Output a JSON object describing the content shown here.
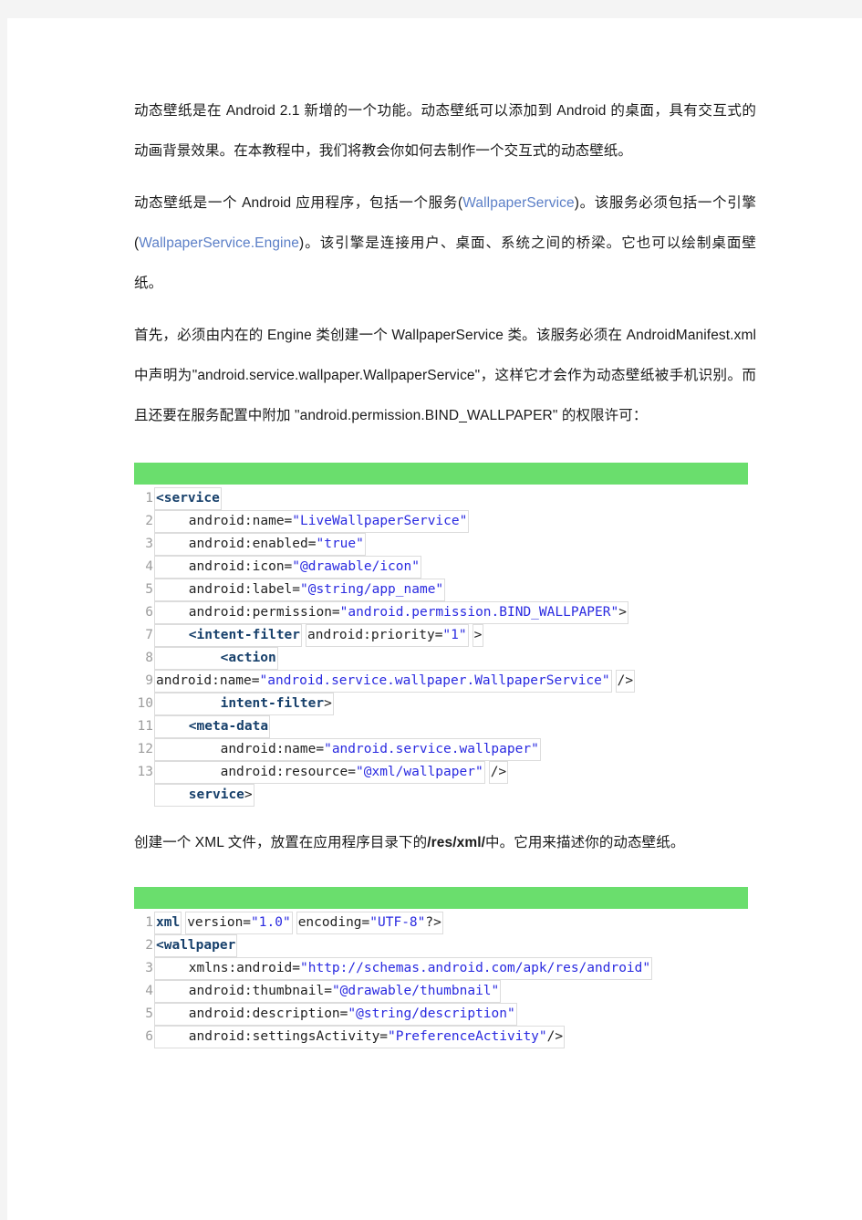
{
  "document": {
    "paragraphs": [
      {
        "id": "p1",
        "runs": [
          {
            "text": "动态壁纸是在 Android 2.1 新增的一个功能。动态壁纸可以添加到 Android 的桌面，具有交互式的动画背景效果。在本教程中，我们将教会你如何去制作一个交互式的动态壁纸。",
            "style": "normal"
          }
        ]
      },
      {
        "id": "p2",
        "runs": [
          {
            "text": "动态壁纸是一个 Android 应用程序，包括一个服务(",
            "style": "normal"
          },
          {
            "text": "WallpaperService",
            "style": "link"
          },
          {
            "text": ")。该服务必须包括一个引擎(",
            "style": "normal"
          },
          {
            "text": "WallpaperService.Engine",
            "style": "link"
          },
          {
            "text": ")。该引擎是连接用户、桌面、系统之间的桥梁。它也可以绘制桌面壁纸。",
            "style": "normal"
          }
        ]
      },
      {
        "id": "p3",
        "runs": [
          {
            "text": "首先，必须由内在的 Engine 类创建一个 WallpaperService 类。该服务必须在 AndroidManifest.xml 中声明为\"android.service.wallpaper.WallpaperService\"，这样它才会作为动态壁纸被手机识别。而且还要在服务配置中附加 \"android.permission.BIND_WALLPAPER\" 的权限许可：",
            "style": "normal"
          }
        ]
      },
      {
        "id": "p4",
        "runs": [
          {
            "text": "创建一个 XML 文件，放置在应用程序目录下的",
            "style": "normal"
          },
          {
            "text": "/res/xml/",
            "style": "bold"
          },
          {
            "text": "中。它用来描述你的动态壁纸。",
            "style": "normal"
          }
        ]
      }
    ],
    "code_blocks": [
      {
        "id": "manifest-service-block",
        "language": "xml",
        "toolbar_color": "#6ade6d",
        "lines": [
          {
            "num": "1",
            "indent": 0,
            "cells": [
              {
                "tokens": [
                  {
                    "t": "<service",
                    "k": "tag"
                  }
                ]
              }
            ]
          },
          {
            "num": "2",
            "indent": 1,
            "cells": [
              {
                "tokens": [
                  {
                    "t": "android:name=",
                    "k": "attr"
                  },
                  {
                    "t": "\"LiveWallpaperService\"",
                    "k": "str"
                  }
                ]
              }
            ]
          },
          {
            "num": "3",
            "indent": 1,
            "cells": [
              {
                "tokens": [
                  {
                    "t": "android:enabled=",
                    "k": "attr"
                  },
                  {
                    "t": "\"true\"",
                    "k": "str"
                  }
                ]
              }
            ]
          },
          {
            "num": "4",
            "indent": 1,
            "cells": [
              {
                "tokens": [
                  {
                    "t": "android:icon=",
                    "k": "attr"
                  },
                  {
                    "t": "\"@drawable/icon\"",
                    "k": "str"
                  }
                ]
              }
            ]
          },
          {
            "num": "5",
            "indent": 1,
            "cells": [
              {
                "tokens": [
                  {
                    "t": "android:label=",
                    "k": "attr"
                  },
                  {
                    "t": "\"@string/app_name\"",
                    "k": "str"
                  }
                ]
              }
            ]
          },
          {
            "num": "6",
            "indent": 1,
            "cells": [
              {
                "tokens": [
                  {
                    "t": "android:permission=",
                    "k": "attr"
                  },
                  {
                    "t": "\"android.permission.BIND_WALLPAPER\"",
                    "k": "str"
                  },
                  {
                    "t": ">",
                    "k": "punct"
                  }
                ]
              }
            ]
          },
          {
            "num": "7",
            "indent": 1,
            "cells": [
              {
                "tokens": [
                  {
                    "t": "<intent-filter",
                    "k": "tag"
                  }
                ]
              },
              {
                "tokens": [
                  {
                    "t": "android:priority=",
                    "k": "attr"
                  },
                  {
                    "t": "\"1\"",
                    "k": "str"
                  }
                ]
              },
              {
                "tokens": [
                  {
                    "t": ">",
                    "k": "punct"
                  }
                ]
              }
            ]
          },
          {
            "num": "8",
            "indent": 2,
            "cells": [
              {
                "tokens": [
                  {
                    "t": "<action",
                    "k": "tag"
                  }
                ]
              }
            ]
          },
          {
            "num": "9",
            "indent": 0,
            "cells": [
              {
                "tokens": [
                  {
                    "t": "android:name=",
                    "k": "attr"
                  },
                  {
                    "t": "\"android.service.wallpaper.WallpaperService\"",
                    "k": "str"
                  }
                ]
              },
              {
                "tokens": [
                  {
                    "t": "/>",
                    "k": "punct"
                  }
                ]
              }
            ]
          },
          {
            "num": "10",
            "indent": 2,
            "cells": [
              {
                "tokens": [
                  {
                    "t": "intent-filter",
                    "k": "tag"
                  },
                  {
                    "t": ">",
                    "k": "punct"
                  }
                ]
              }
            ]
          },
          {
            "num": "11",
            "indent": 1,
            "cells": [
              {
                "tokens": [
                  {
                    "t": "<meta-data",
                    "k": "tag"
                  }
                ]
              }
            ]
          },
          {
            "num": "12",
            "indent": 2,
            "cells": [
              {
                "tokens": [
                  {
                    "t": "android:name=",
                    "k": "attr"
                  },
                  {
                    "t": "\"android.service.wallpaper\"",
                    "k": "str"
                  }
                ]
              }
            ]
          },
          {
            "num": "13",
            "indent": 2,
            "cells": [
              {
                "tokens": [
                  {
                    "t": "android:resource=",
                    "k": "attr"
                  },
                  {
                    "t": "\"@xml/wallpaper\"",
                    "k": "str"
                  }
                ]
              },
              {
                "tokens": [
                  {
                    "t": "/>",
                    "k": "punct"
                  }
                ]
              }
            ]
          },
          {
            "num": "",
            "indent": 1,
            "cells": [
              {
                "tokens": [
                  {
                    "t": "service",
                    "k": "tag"
                  },
                  {
                    "t": ">",
                    "k": "punct"
                  }
                ]
              }
            ]
          }
        ]
      },
      {
        "id": "wallpaper-xml-block",
        "language": "xml",
        "toolbar_color": "#6ade6d",
        "lines": [
          {
            "num": "1",
            "indent": 0,
            "cells": [
              {
                "tokens": [
                  {
                    "t": "xml",
                    "k": "tag"
                  }
                ]
              },
              {
                "tokens": [
                  {
                    "t": "version=",
                    "k": "attr"
                  },
                  {
                    "t": "\"1.0\"",
                    "k": "str"
                  }
                ]
              },
              {
                "tokens": [
                  {
                    "t": "encoding=",
                    "k": "attr"
                  },
                  {
                    "t": "\"UTF-8\"",
                    "k": "str"
                  },
                  {
                    "t": "?>",
                    "k": "punct"
                  }
                ]
              }
            ]
          },
          {
            "num": "2",
            "indent": 0,
            "cells": [
              {
                "tokens": [
                  {
                    "t": "<wallpaper",
                    "k": "tag"
                  }
                ]
              }
            ]
          },
          {
            "num": "3",
            "indent": 1,
            "cells": [
              {
                "tokens": [
                  {
                    "t": "xmlns:android=",
                    "k": "attr"
                  },
                  {
                    "t": "\"http://schemas.android.com/apk/res/android\"",
                    "k": "str"
                  }
                ]
              }
            ]
          },
          {
            "num": "4",
            "indent": 1,
            "cells": [
              {
                "tokens": [
                  {
                    "t": "android:thumbnail=",
                    "k": "attr"
                  },
                  {
                    "t": "\"@drawable/thumbnail\"",
                    "k": "str"
                  }
                ]
              }
            ]
          },
          {
            "num": "5",
            "indent": 1,
            "cells": [
              {
                "tokens": [
                  {
                    "t": "android:description=",
                    "k": "attr"
                  },
                  {
                    "t": "\"@string/description\"",
                    "k": "str"
                  }
                ]
              }
            ]
          },
          {
            "num": "6",
            "indent": 1,
            "cells": [
              {
                "tokens": [
                  {
                    "t": "android:settingsActivity=",
                    "k": "attr"
                  },
                  {
                    "t": "\"PreferenceActivity\"",
                    "k": "str"
                  },
                  {
                    "t": "/>",
                    "k": "punct"
                  }
                ]
              }
            ]
          }
        ]
      }
    ]
  },
  "colors": {
    "page_background": "#ffffff",
    "canvas_background": "#f4f4f4",
    "toolbar_green": "#6ade6d",
    "link_blue": "#5b7fc7",
    "code_string": "#2a2ae0",
    "code_tag": "#17406b",
    "line_number": "#9d9d9d",
    "cell_border": "#dcdcdc",
    "body_text": "#1a1a1a"
  }
}
